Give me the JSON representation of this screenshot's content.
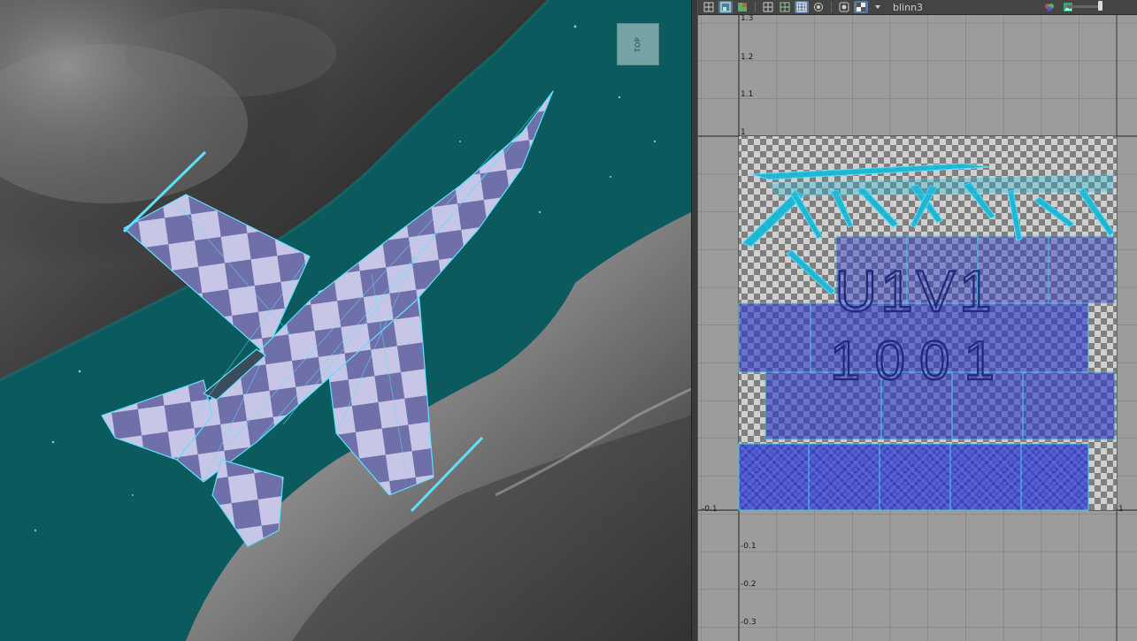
{
  "viewcube": {
    "label": "TOP"
  },
  "uv_editor": {
    "material_name": "blinn3",
    "tile_label": "U1V1",
    "tile_number": "1001",
    "axis_ticks": {
      "v": [
        "1.3",
        "1.2",
        "1.1",
        "1",
        "-0.1",
        "-0.2",
        "-0.3"
      ],
      "u": [
        "-0.1",
        "1"
      ]
    }
  },
  "colors": {
    "water": "#0b5a5d",
    "wireframe": "#5fe0ff",
    "uv_shell": "#2a35c8",
    "grid_bg": "#9c9c9c"
  },
  "icons": {
    "toolbar": [
      "grid-icon",
      "uv-shell-icon",
      "texture-icon",
      "frame-icon",
      "frame-all-icon",
      "checker-grid-icon",
      "isolate-icon",
      "camera-icon",
      "checker-toggle-icon",
      "dropdown-icon",
      "rgb-icon",
      "image-icon"
    ]
  }
}
